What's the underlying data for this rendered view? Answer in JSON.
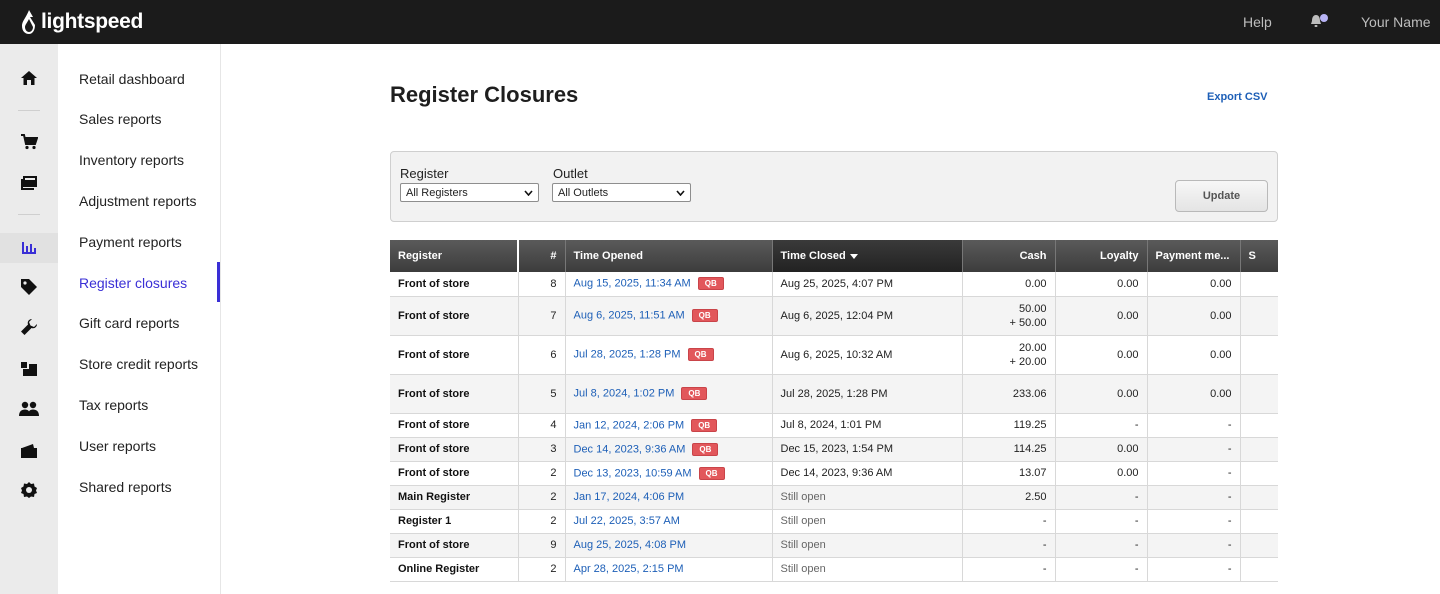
{
  "topbar": {
    "brand": "lightspeed",
    "help": "Help",
    "user_name": "Your Name"
  },
  "rail": {
    "icons": [
      "home-icon",
      "cart-icon",
      "catalog-icon",
      "reports-icon",
      "tag-icon",
      "wrench-icon",
      "inventory-icon",
      "customers-icon",
      "wallet-icon",
      "settings-icon"
    ]
  },
  "subnav": {
    "items": [
      {
        "label": "Retail dashboard"
      },
      {
        "label": "Sales reports"
      },
      {
        "label": "Inventory reports"
      },
      {
        "label": "Adjustment reports"
      },
      {
        "label": "Payment reports"
      },
      {
        "label": "Register closures"
      },
      {
        "label": "Gift card reports"
      },
      {
        "label": "Store credit reports"
      },
      {
        "label": "Tax reports"
      },
      {
        "label": "User reports"
      },
      {
        "label": "Shared reports"
      }
    ],
    "active": "Register closures"
  },
  "page": {
    "title": "Register Closures",
    "export_label": "Export CSV"
  },
  "filters": {
    "register_label": "Register",
    "register_value": "All Registers",
    "outlet_label": "Outlet",
    "outlet_value": "All Outlets",
    "update_label": "Update"
  },
  "table": {
    "headers": {
      "register": "Register",
      "num": "#",
      "opened": "Time Opened",
      "closed": "Time Closed",
      "cash": "Cash",
      "loyalty": "Loyalty",
      "payment": "Payment me...",
      "more": "S"
    },
    "badge": "QB",
    "rows": [
      {
        "register": "Front of store",
        "num": "8",
        "opened": "Aug 15, 2025, 11:34 AM",
        "qb": true,
        "closed": "Aug 25, 2025, 4:07 PM",
        "cash": "0.00",
        "cash2": "",
        "loyalty": "0.00",
        "payment": "0.00"
      },
      {
        "register": "Front of store",
        "num": "7",
        "opened": "Aug 6, 2025, 11:51 AM",
        "qb": true,
        "closed": "Aug 6, 2025, 12:04 PM",
        "cash": "50.00",
        "cash2": "+ 50.00",
        "loyalty": "0.00",
        "payment": "0.00"
      },
      {
        "register": "Front of store",
        "num": "6",
        "opened": "Jul 28, 2025, 1:28 PM",
        "qb": true,
        "closed": "Aug 6, 2025, 10:32 AM",
        "cash": "20.00",
        "cash2": "+ 20.00",
        "loyalty": "0.00",
        "payment": "0.00"
      },
      {
        "register": "Front of store",
        "num": "5",
        "opened": "Jul 8, 2024, 1:02 PM",
        "qb": true,
        "closed": "Jul 28, 2025, 1:28 PM",
        "cash": "233.06",
        "cash2": "",
        "loyalty": "0.00",
        "payment": "0.00"
      },
      {
        "register": "Front of store",
        "num": "4",
        "opened": "Jan 12, 2024, 2:06 PM",
        "qb": true,
        "closed": "Jul 8, 2024, 1:01 PM",
        "cash": "119.25",
        "cash2": "",
        "loyalty": "-",
        "payment": "-"
      },
      {
        "register": "Front of store",
        "num": "3",
        "opened": "Dec 14, 2023, 9:36 AM",
        "qb": true,
        "closed": "Dec 15, 2023, 1:54 PM",
        "cash": "114.25",
        "cash2": "",
        "loyalty": "0.00",
        "payment": "-"
      },
      {
        "register": "Front of store",
        "num": "2",
        "opened": "Dec 13, 2023, 10:59 AM",
        "qb": true,
        "closed": "Dec 14, 2023, 9:36 AM",
        "cash": "13.07",
        "cash2": "",
        "loyalty": "0.00",
        "payment": "-"
      },
      {
        "register": "Main Register",
        "num": "2",
        "opened": "Jan 17, 2024, 4:06 PM",
        "qb": false,
        "closed": "Still open",
        "cash": "2.50",
        "cash2": "",
        "loyalty": "-",
        "payment": "-"
      },
      {
        "register": "Register 1",
        "num": "2",
        "opened": "Jul 22, 2025, 3:57 AM",
        "qb": false,
        "closed": "Still open",
        "cash": "-",
        "cash2": "",
        "loyalty": "-",
        "payment": "-"
      },
      {
        "register": "Front of store",
        "num": "9",
        "opened": "Aug 25, 2025, 4:08 PM",
        "qb": false,
        "closed": "Still open",
        "cash": "-",
        "cash2": "",
        "loyalty": "-",
        "payment": "-"
      },
      {
        "register": "Online Register",
        "num": "2",
        "opened": "Apr 28, 2025, 2:15 PM",
        "qb": false,
        "closed": "Still open",
        "cash": "-",
        "cash2": "",
        "loyalty": "-",
        "payment": "-"
      }
    ]
  },
  "colors": {
    "topbar": "#1b1b1b",
    "accent": "#3a2fd6",
    "link": "#1d5fb7",
    "badge": "#e2575b"
  }
}
